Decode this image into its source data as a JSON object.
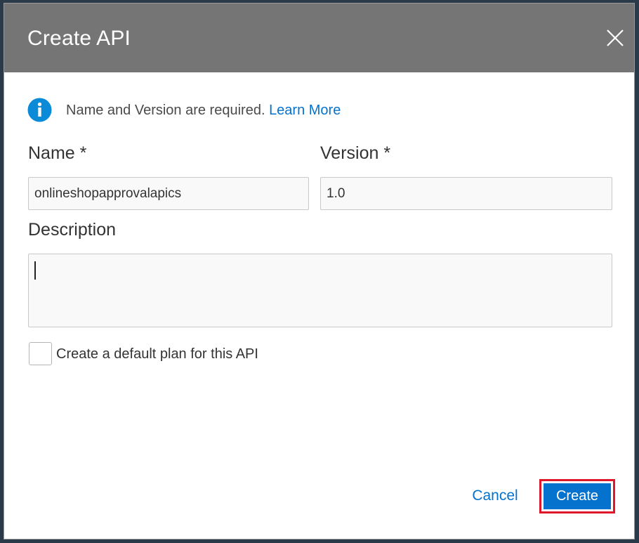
{
  "dialog": {
    "title": "Create API",
    "close_icon": "close-icon",
    "header_color": "#757575"
  },
  "info": {
    "icon": "info-icon",
    "message": "Name and Version are required.",
    "link_label": "Learn More"
  },
  "form": {
    "name_label": "Name *",
    "name_value": "onlineshopapprovalapics",
    "version_label": "Version *",
    "version_value": "1.0",
    "description_label": "Description",
    "description_value": "",
    "default_plan_label": "Create a default plan for this API",
    "default_plan_checked": false
  },
  "actions": {
    "cancel_label": "Cancel",
    "create_label": "Create",
    "accent_color": "#0572ce",
    "highlight_color": "#e0162b"
  }
}
